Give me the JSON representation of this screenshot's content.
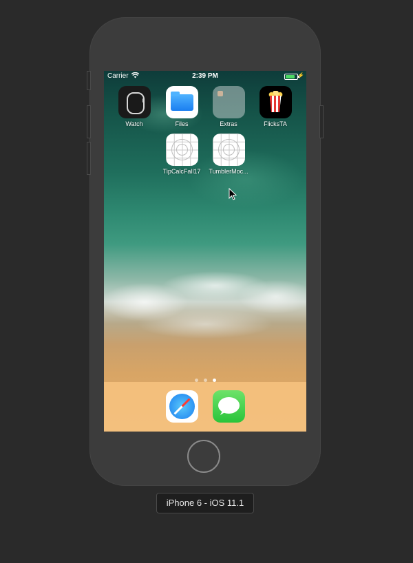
{
  "device_label": "iPhone 6 - iOS 11.1",
  "status_bar": {
    "carrier": "Carrier",
    "wifi_icon": "wifi-icon",
    "time": "2:39 PM",
    "battery_icon": "battery-icon",
    "battery_level": 0.9,
    "battery_color": "#4cd964"
  },
  "home_screen": {
    "apps": [
      {
        "label": "Watch",
        "icon": "watch-icon"
      },
      {
        "label": "Files",
        "icon": "files-icon"
      },
      {
        "label": "Extras",
        "icon": "folder-icon"
      },
      {
        "label": "FlicksTA",
        "icon": "popcorn-icon"
      },
      {
        "label": "TipCalcFall17",
        "icon": "blank-app-icon"
      },
      {
        "label": "TumblerMoc...",
        "icon": "blank-app-icon"
      }
    ],
    "page_count": 3,
    "active_page": 3
  },
  "dock": {
    "apps": [
      {
        "name": "Safari",
        "icon": "safari-icon"
      },
      {
        "name": "Messages",
        "icon": "messages-icon"
      }
    ]
  }
}
